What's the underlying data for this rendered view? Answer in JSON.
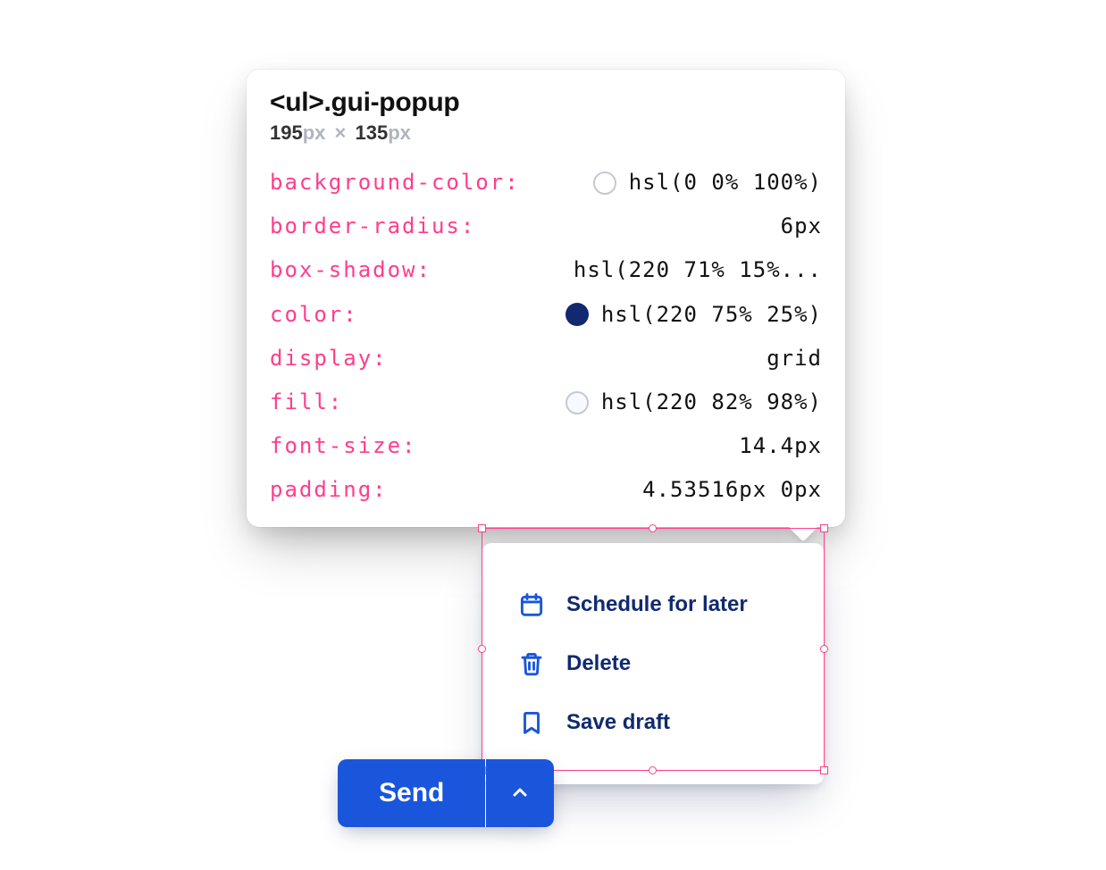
{
  "inspector": {
    "selector_tag": "<ul>",
    "selector_class": ".gui-popup",
    "width": "195",
    "height": "135",
    "unit": "px",
    "props": [
      {
        "name": "background-color",
        "value": "hsl(0 0% 100%)",
        "swatch": "#ffffff",
        "swatch_filled": false
      },
      {
        "name": "border-radius",
        "value": "6px"
      },
      {
        "name": "box-shadow",
        "value": "hsl(220 71% 15%..."
      },
      {
        "name": "color",
        "value": "hsl(220 75% 25%)",
        "swatch": "#10296f",
        "swatch_filled": true
      },
      {
        "name": "display",
        "value": "grid"
      },
      {
        "name": "fill",
        "value": "hsl(220 82% 98%)",
        "swatch": "#f6f9fe",
        "swatch_filled": false
      },
      {
        "name": "font-size",
        "value": "14.4px"
      },
      {
        "name": "padding",
        "value": "4.53516px 0px"
      }
    ]
  },
  "popup": {
    "items": [
      {
        "icon": "calendar-icon",
        "label": "Schedule for later"
      },
      {
        "icon": "trash-icon",
        "label": "Delete"
      },
      {
        "icon": "bookmark-icon",
        "label": "Save draft"
      }
    ]
  },
  "send_button": {
    "label": "Send"
  }
}
